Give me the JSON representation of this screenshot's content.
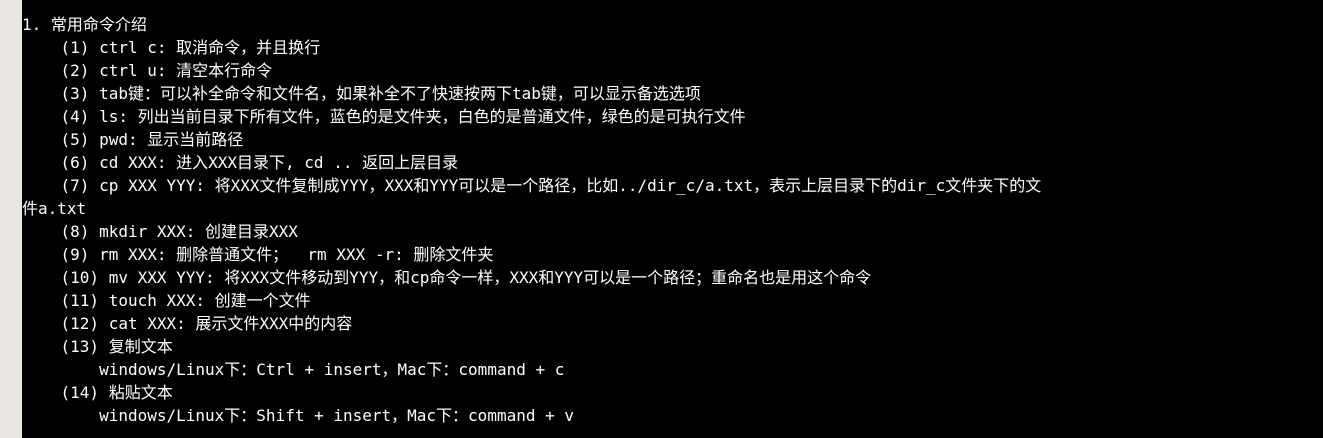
{
  "terminal": {
    "lines": [
      "1. 常用命令介绍",
      "    (1) ctrl c: 取消命令，并且换行",
      "    (2) ctrl u: 清空本行命令",
      "    (3) tab键：可以补全命令和文件名，如果补全不了快速按两下tab键，可以显示备选选项",
      "    (4) ls: 列出当前目录下所有文件，蓝色的是文件夹，白色的是普通文件，绿色的是可执行文件",
      "    (5) pwd: 显示当前路径",
      "    (6) cd XXX: 进入XXX目录下, cd .. 返回上层目录",
      "    (7) cp XXX YYY: 将XXX文件复制成YYY，XXX和YYY可以是一个路径，比如../dir_c/a.txt，表示上层目录下的dir_c文件夹下的文",
      "件a.txt",
      "    (8) mkdir XXX: 创建目录XXX",
      "    (9) rm XXX: 删除普通文件；  rm XXX -r: 删除文件夹",
      "    (10) mv XXX YYY: 将XXX文件移动到YYY，和cp命令一样，XXX和YYY可以是一个路径；重命名也是用这个命令",
      "    (11) touch XXX: 创建一个文件",
      "    (12) cat XXX: 展示文件XXX中的内容",
      "    (13) 复制文本",
      "        windows/Linux下：Ctrl + insert，Mac下：command + c",
      "    (14) 粘贴文本",
      "        windows/Linux下：Shift + insert，Mac下：command + v"
    ]
  },
  "colors": {
    "terminal_background": "#000000",
    "text": "#ffffff",
    "page_background": "#eae7e2"
  }
}
